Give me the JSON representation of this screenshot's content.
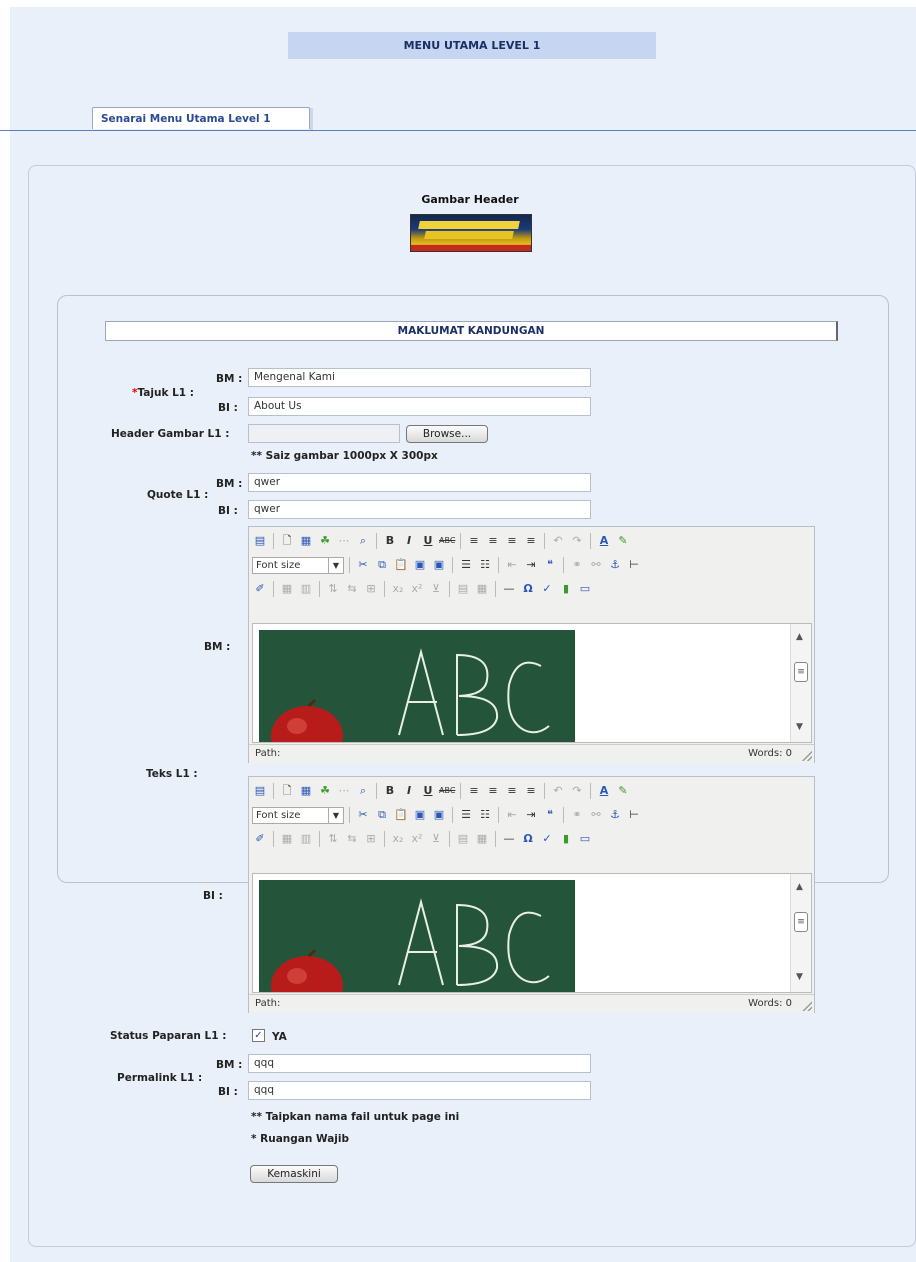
{
  "header": {
    "title": "MENU UTAMA LEVEL 1"
  },
  "tabs": [
    {
      "label": "Senarai Menu Utama Level 1"
    }
  ],
  "gambar_header": {
    "title": "Gambar Header"
  },
  "section": {
    "title": "MAKLUMAT KANDUNGAN"
  },
  "form": {
    "tajuk": {
      "label_req": "*",
      "label": "Tajuk L1 :",
      "bm_label": "BM :",
      "bi_label": "BI :",
      "bm_value": "Mengenal Kami",
      "bi_value": "About Us"
    },
    "header_gambar": {
      "label": "Header Gambar L1 :",
      "browse_label": "Browse...",
      "note": "** Saiz gambar 1000px X 300px"
    },
    "quote": {
      "label": "Quote L1 :",
      "bm_label": "BM :",
      "bi_label": "BI :",
      "bm_value": "qwer",
      "bi_value": "qwer"
    },
    "teks": {
      "label": "Teks L1 :",
      "bm_label": "BM :",
      "bi_label": "BI :",
      "editor": {
        "font_size_label": "Font size",
        "path_label": "Path:",
        "words_label": "Words: 0"
      }
    },
    "status": {
      "label": "Status Paparan L1 :",
      "checked": true,
      "value_label": "YA"
    },
    "permalink": {
      "label": "Permalink L1 :",
      "bm_label": "BM :",
      "bi_label": "BI :",
      "bm_value": "qqq",
      "bi_value": "qqq",
      "note": "** Taipkan nama fail untuk page ini"
    },
    "required_note": "* Ruangan Wajib",
    "submit_label": "Kemaskini"
  },
  "colors": {
    "accent": "#2b4a93",
    "required": "#e00000",
    "page_bg": "#e9f0f9",
    "title_bar": "#c6d5f2"
  }
}
